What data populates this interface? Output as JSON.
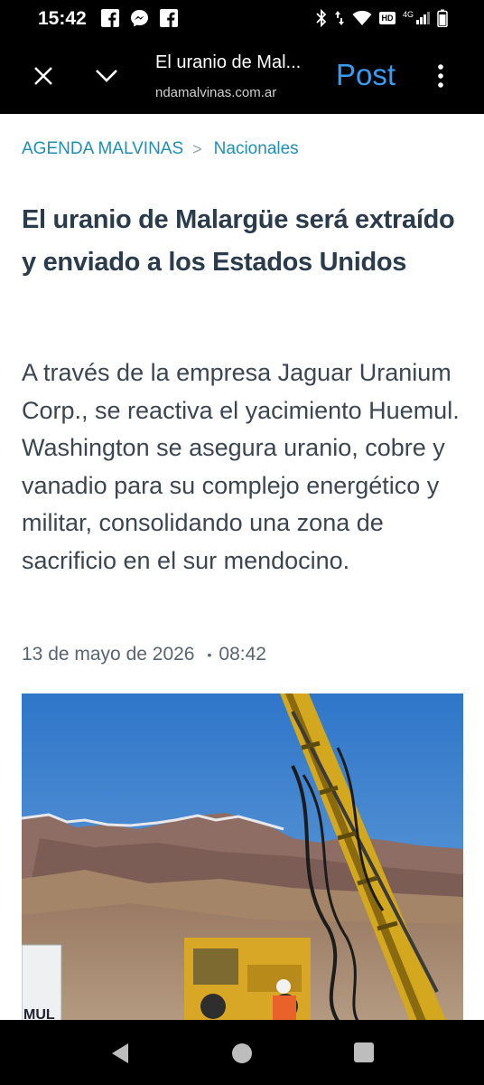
{
  "status_bar": {
    "time": "15:42",
    "left_icons": [
      "facebook-icon",
      "messenger-icon",
      "facebook-icon"
    ],
    "right_icons": [
      "bluetooth-icon",
      "data-arrows-icon",
      "wifi-icon",
      "hd-icon",
      "4g-signal-icon",
      "battery-icon"
    ],
    "hd_label": "HD",
    "network_label": "4G"
  },
  "toolbar": {
    "title": "El uranio de Mal...",
    "url": "ndamalvinas.com.ar",
    "post_label": "Post"
  },
  "breadcrumb": {
    "site": "AGENDA MALVINAS",
    "separator": ">",
    "section": "Nacionales"
  },
  "article": {
    "headline": "El uranio de Malargüe será extraído y enviado a los Estados Unidos",
    "summary": "A través de la empresa Jaguar Uranium Corp., se reactiva el yacimiento Huemul. Washington se asegura uranio, cobre y vanadio para su complejo energético y militar, consolidando una zona de sacrificio en el sur mendocino.",
    "date": "13 de mayo de 2026",
    "meta_separator": "•",
    "time": "08:42",
    "image_sign_text": "MUL"
  },
  "colors": {
    "link": "#1f8fb3",
    "headline": "#2a3b4c",
    "post_button": "#3a9cf0"
  }
}
